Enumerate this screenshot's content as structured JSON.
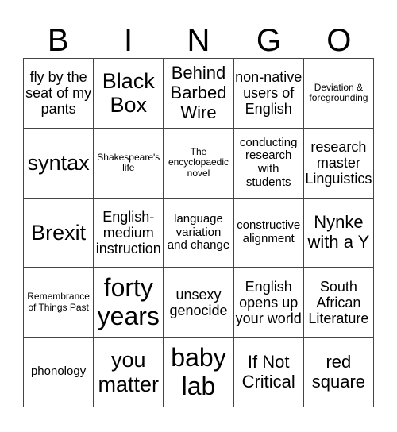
{
  "header": [
    "B",
    "I",
    "N",
    "G",
    "O"
  ],
  "cells": [
    [
      "fly by the seat of my pants",
      "Black Box",
      "Behind Barbed Wire",
      "non-native users of English",
      "Deviation & foregrounding"
    ],
    [
      "syntax",
      "Shakespeare's life",
      "The encyclopaedic novel",
      "conducting research with students",
      "research master Linguistics"
    ],
    [
      "Brexit",
      "English-medium instruction",
      "language variation and change",
      "constructive alignment",
      "Nynke with a Y"
    ],
    [
      "Remembrance of Things Past",
      "forty years",
      "unsexy genocide",
      "English opens up your world",
      "South African Literature"
    ],
    [
      "phonology",
      "you matter",
      "baby lab",
      "If Not Critical",
      "red square"
    ]
  ]
}
